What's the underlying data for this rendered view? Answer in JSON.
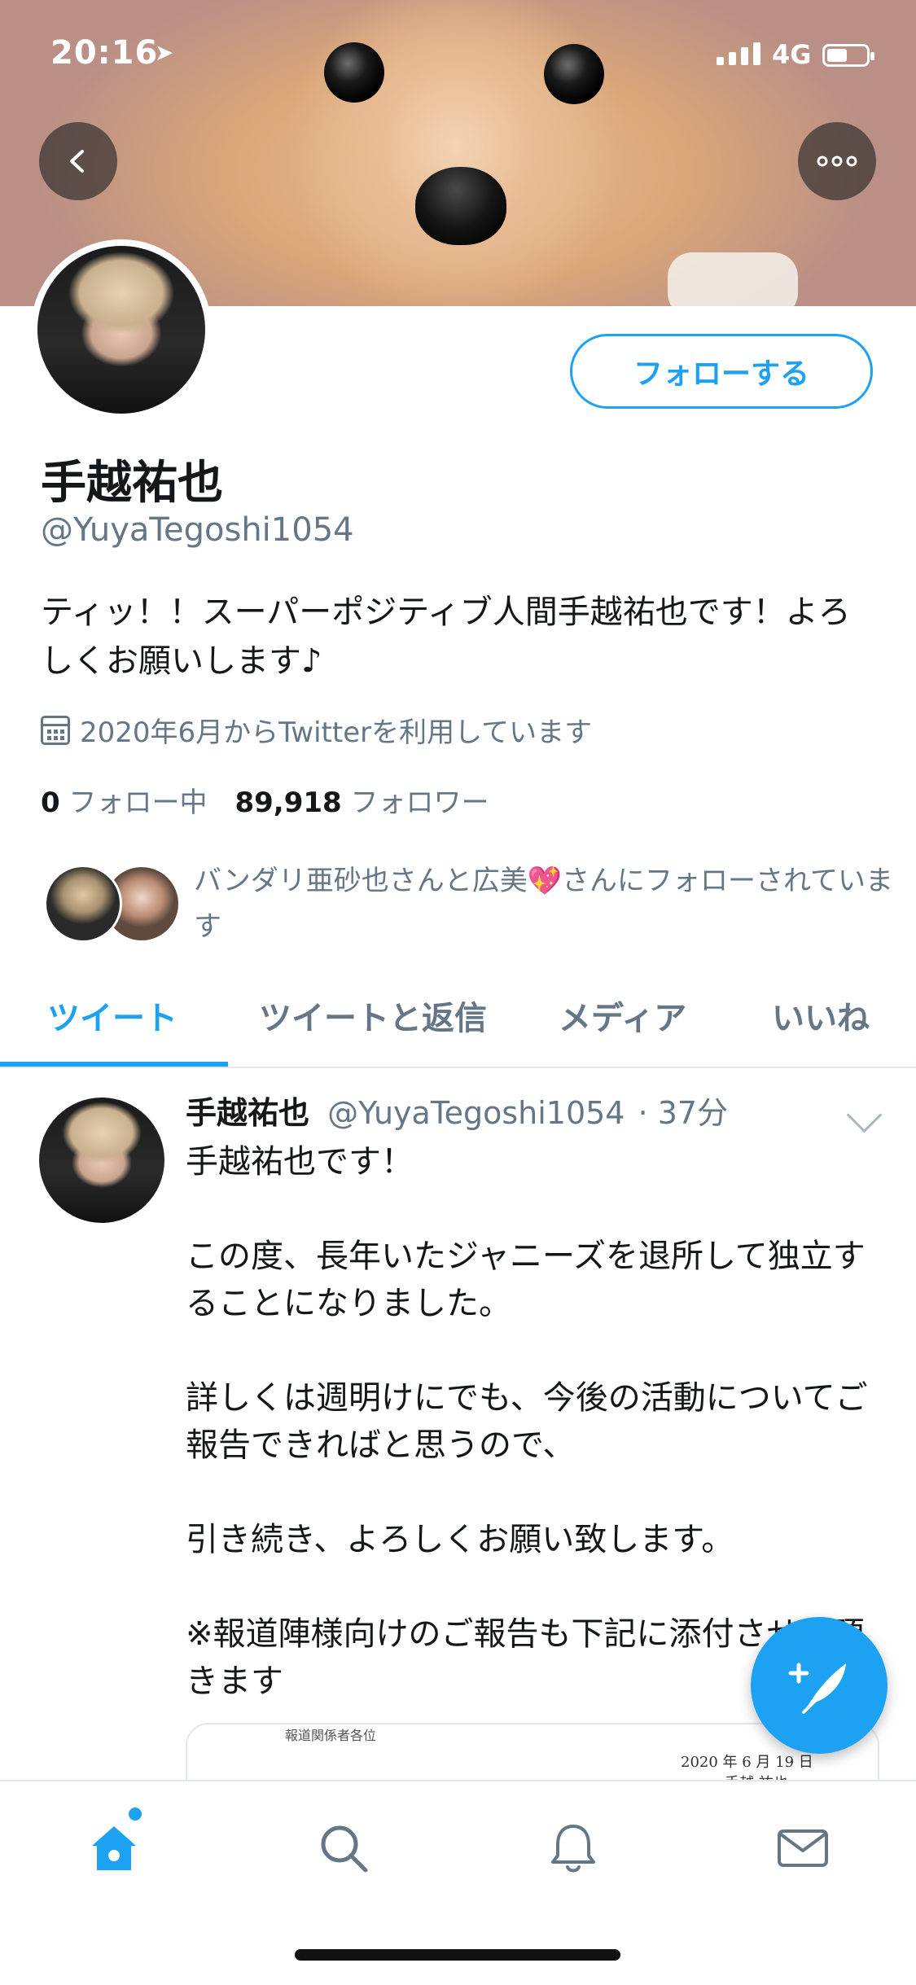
{
  "status_bar": {
    "time": "20:16",
    "location_glyph": "➤",
    "network": "4G"
  },
  "header": {
    "back_icon": "chevron-left-icon",
    "more_icon": "more-horizontal-icon"
  },
  "profile": {
    "follow_label": "フォローする",
    "name": "手越祐也",
    "handle": "@YuyaTegoshi1054",
    "bio": "ティッ！！スーパーポジティブ人間手越祐也です！よろしくお願いします♪",
    "joined": "2020年6月からTwitterを利用しています",
    "following_count": "0",
    "following_label": "フォロー中",
    "followers_count": "89,918",
    "followers_label": "フォロワー",
    "followed_by": "バンダリ亜砂也さんと広美💖さんにフォローされています"
  },
  "tabs": [
    {
      "label": "ツイート",
      "active": true
    },
    {
      "label": "ツイートと返信",
      "active": false
    },
    {
      "label": "メディア",
      "active": false
    },
    {
      "label": "いいね",
      "active": false
    }
  ],
  "tweet": {
    "name": "手越祐也",
    "handle": "@YuyaTegoshi1054",
    "time": "· 37分",
    "lines": [
      "手越祐也です！",
      "",
      "この度、長年いたジャニーズを退所して独立することになりました。",
      "",
      "詳しくは週明けにでも、今後の活動についてご報告できればと思うので、",
      "",
      "引き続き、よろしくお願い致します。",
      "",
      "※報道陣様向けのご報告も下記に添付させて頂きます"
    ],
    "attachment": {
      "header_text": "報道関係者各位",
      "date": "2020 年 6 月 19 日",
      "signature": "手越 祐也"
    }
  },
  "colors": {
    "accent": "#1da1f2",
    "secondary_text": "#657786"
  },
  "bottom_nav": [
    {
      "name": "home-icon",
      "active": true
    },
    {
      "name": "search-icon",
      "active": false
    },
    {
      "name": "notifications-bell-icon",
      "active": false
    },
    {
      "name": "messages-envelope-icon",
      "active": false
    }
  ]
}
